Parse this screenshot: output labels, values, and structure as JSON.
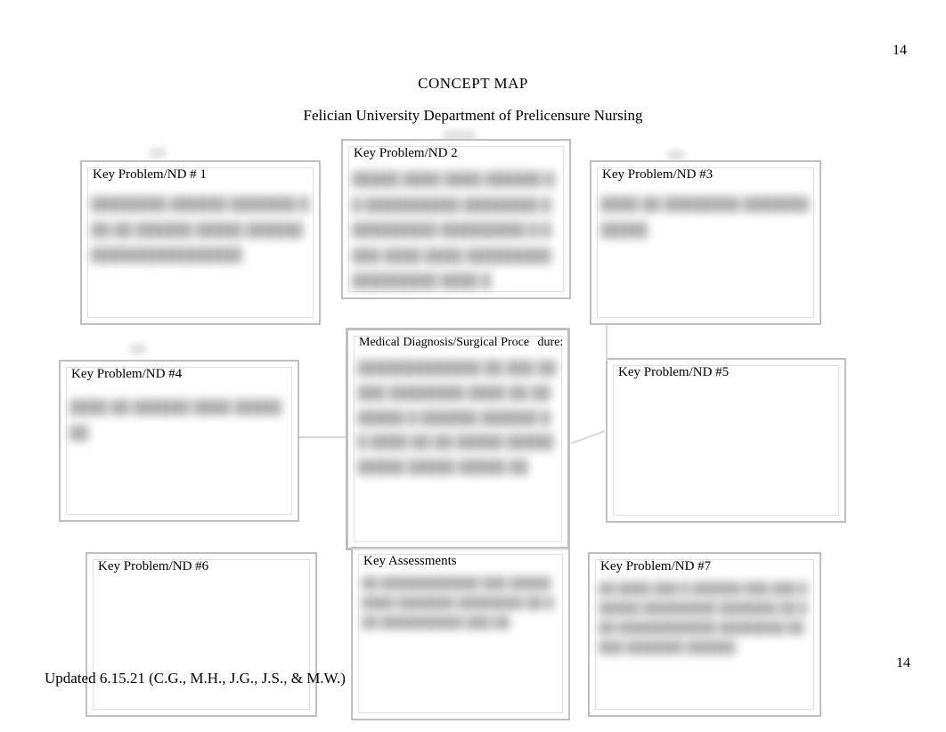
{
  "page_number_top": "14",
  "page_number_bottom": "14",
  "title": "CONCEPT MAP",
  "subtitle": "Felician University Department of Prelicensure Nursing",
  "footer": "Updated 6.15.21 (C.G., M.H., J.G., J.S., & M.W.)",
  "boxes": {
    "nd1": {
      "label": "Key Problem/ND # 1"
    },
    "nd2": {
      "label": "Key Problem/ND 2"
    },
    "nd3": {
      "label": "Key Problem/ND #3"
    },
    "nd4": {
      "label": "Key Problem/ND #4"
    },
    "nd5": {
      "label": "Key Problem/ND #5"
    },
    "nd6": {
      "label": "Key Problem/ND #6"
    },
    "nd7": {
      "label": "Key Problem/ND #7"
    },
    "med": {
      "label": "Medical Diagnosis/Surgical Proce",
      "label_extra": "dure:"
    },
    "assess": {
      "label": "Key Assessments"
    }
  }
}
